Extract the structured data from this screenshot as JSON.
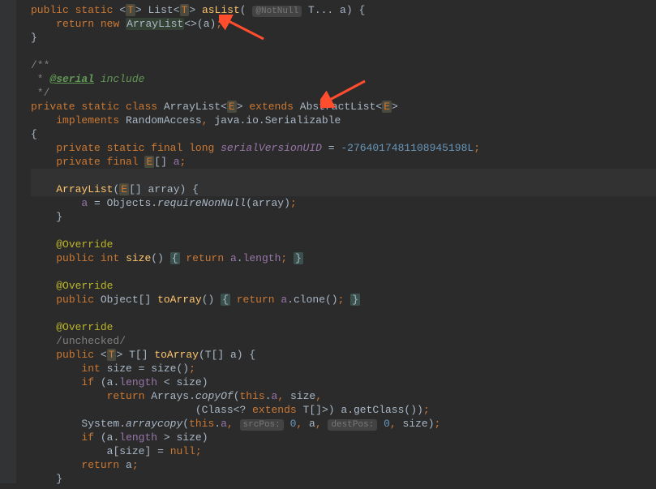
{
  "code": {
    "l1": {
      "public": "public",
      "static": "static",
      "open": "<",
      "T": "T",
      "close": ">",
      "List": "List",
      "asList": "asList",
      "lp": "(",
      "anno": "@NotNull",
      "typ": "T",
      "dots": "...",
      "a": "a",
      "rp": ")",
      "brace": "{"
    },
    "l2": {
      "ret": "return",
      "new": "new",
      "ArrayList": "ArrayList",
      "diamond": "<>",
      "lp": "(",
      "a": "a",
      "rp": ")",
      "semi": ";"
    },
    "l3": {
      "brace": "}"
    },
    "l4": "",
    "l5": {
      "c": "/**"
    },
    "l6": {
      "star": " * ",
      "tag": "@serial",
      "rest": " include"
    },
    "l7": {
      "c": " */"
    },
    "l8": {
      "priv": "private",
      "static": "static",
      "cls": "class",
      "name": "ArrayList",
      "open": "<",
      "E": "E",
      "close": ">",
      "ext": "extends",
      "abs": "AbstractList",
      "open2": "<",
      "E2": "E",
      "close2": ">"
    },
    "l9": {
      "impl": "implements",
      "ra": "RandomAccess",
      "comma": ",",
      "ser": "java.io.Serializable"
    },
    "l10": {
      "brace": "{"
    },
    "l11": {
      "priv": "private",
      "static": "static",
      "final": "final",
      "long": "long",
      "sv": "serialVersionUID",
      "eq": " = ",
      "num": "-2764017481108945198L",
      "semi": ";"
    },
    "l12": {
      "priv": "private",
      "final": "final",
      "E": "E",
      "br": "[]",
      "a": "a",
      "semi": ";"
    },
    "l13": "",
    "l14": {
      "ctor": "ArrayList",
      "lp": "(",
      "E": "E",
      "br": "[]",
      "arr": "array",
      "rp": ")",
      "brace": "{"
    },
    "l15": {
      "a": "a",
      "eq": " = ",
      "obj": "Objects",
      "dot": ".",
      "req": "requireNonNull",
      "lp": "(",
      "arr": "array",
      "rp": ")",
      "semi": ";"
    },
    "l16": {
      "brace": "}"
    },
    "l17": "",
    "l18": {
      "anno": "@Override"
    },
    "l19": {
      "pub": "public",
      "int": "int",
      "fn": "size",
      "lp": "()",
      "fold1": "{",
      "ret": "return",
      "a": "a",
      "dot": ".",
      "len": "length",
      "semi": ";",
      "fold2": "}"
    },
    "l20": "",
    "l21": {
      "anno": "@Override"
    },
    "l22": {
      "pub": "public",
      "obj": "Object",
      "br": "[]",
      "fn": "toArray",
      "lp": "()",
      "fold1": "{",
      "ret": "return",
      "a": "a",
      "dot": ".",
      "clone": "clone",
      "lp2": "()",
      "semi": ";",
      "fold2": "}"
    },
    "l23": "",
    "l24": {
      "anno": "@Override"
    },
    "l25": {
      "unchecked": "/unchecked/"
    },
    "l26": {
      "pub": "public",
      "open": "<",
      "T": "T",
      "close": ">",
      "T2": "T",
      "br": "[]",
      "fn": "toArray",
      "lp": "(",
      "T3": "T",
      "br2": "[]",
      "a": "a",
      "rp": ")",
      "brace": "{"
    },
    "l27": {
      "int": "int",
      "size": "size",
      "eq": " = ",
      "fn": "size",
      "lp": "()",
      "semi": ";"
    },
    "l28": {
      "if": "if",
      "lp": "(",
      "a": "a",
      "dot": ".",
      "len": "length",
      "lt": " < ",
      "sz": "size",
      "rp": ")"
    },
    "l29": {
      "ret": "return",
      "arrs": "Arrays",
      "dot": ".",
      "fn": "copyOf",
      "lp": "(",
      "this": "this",
      "dot2": ".",
      "a": "a",
      "c": ",",
      "sz": "size",
      "c2": ","
    },
    "l30": {
      "lp": "(",
      "cls": "Class",
      "open": "<?",
      "ext": "extends",
      "T": "T",
      "br": "[]",
      "close": ">",
      "rp": ")",
      "a": "a",
      "dot": ".",
      "gc": "getClass",
      "lp2": "()",
      "rp2": ")",
      "semi": ";"
    },
    "l31": {
      "sys": "System",
      "dot": ".",
      "fn": "arraycopy",
      "lp": "(",
      "this": "this",
      "dot2": ".",
      "a": "a",
      "c": ",",
      "h1": "srcPos:",
      "z1": "0",
      "c2": ",",
      "a2": "a",
      "c3": ",",
      "h2": "destPos:",
      "z2": "0",
      "c4": ",",
      "sz": "size",
      "rp": ")",
      "semi": ";"
    },
    "l32": {
      "if": "if",
      "lp": "(",
      "a": "a",
      "dot": ".",
      "len": "length",
      "gt": " > ",
      "sz": "size",
      "rp": ")"
    },
    "l33": {
      "a": "a",
      "lb": "[",
      "sz": "size",
      "rb": "]",
      "eq": " = ",
      "null": "null",
      "semi": ";"
    },
    "l34": {
      "ret": "return",
      "a": "a",
      "semi": ";"
    },
    "l35": {
      "brace": "}"
    }
  }
}
